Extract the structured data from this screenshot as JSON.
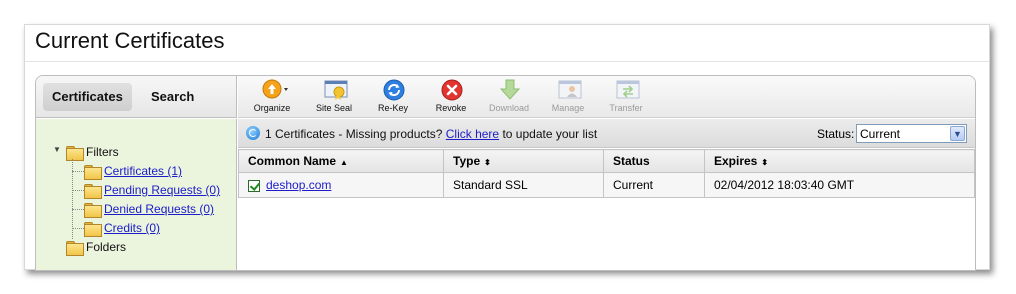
{
  "page_title": "Current Certificates",
  "tabs": [
    {
      "label": "Certificates",
      "active": true
    },
    {
      "label": "Search",
      "active": false
    }
  ],
  "tree": {
    "filters_label": "Filters",
    "items": [
      {
        "label": "Certificates (1)"
      },
      {
        "label": "Pending Requests (0)"
      },
      {
        "label": "Denied Requests (0)"
      },
      {
        "label": "Credits (0)"
      }
    ],
    "folders_label": "Folders"
  },
  "toolbar": {
    "items": [
      {
        "label": "Organize",
        "icon": "organize-icon",
        "enabled": true
      },
      {
        "label": "Site Seal",
        "icon": "site-seal-icon",
        "enabled": true
      },
      {
        "label": "Re-Key",
        "icon": "rekey-icon",
        "enabled": true
      },
      {
        "label": "Revoke",
        "icon": "revoke-icon",
        "enabled": true
      },
      {
        "label": "Download",
        "icon": "download-icon",
        "enabled": false
      },
      {
        "label": "Manage",
        "icon": "manage-icon",
        "enabled": false
      },
      {
        "label": "Transfer",
        "icon": "transfer-icon",
        "enabled": false
      }
    ]
  },
  "info": {
    "message": "1 Certificates - Missing products?",
    "link": "Click here",
    "suffix": "to update your list",
    "status_label": "Status:",
    "status_value": "Current"
  },
  "table": {
    "columns": [
      "Common Name",
      "Type",
      "Status",
      "Expires"
    ],
    "sort_indicators": [
      "▲",
      "⬍",
      "",
      "⬍"
    ],
    "rows": [
      {
        "name": "deshop.com",
        "type": "Standard SSL",
        "status": "Current",
        "expires": "02/04/2012 18:03:40 GMT",
        "checked": true
      }
    ]
  },
  "colors": {
    "link": "#1c1cc8",
    "tree_background": "#ebf4dc",
    "folder": "#f1c449"
  }
}
